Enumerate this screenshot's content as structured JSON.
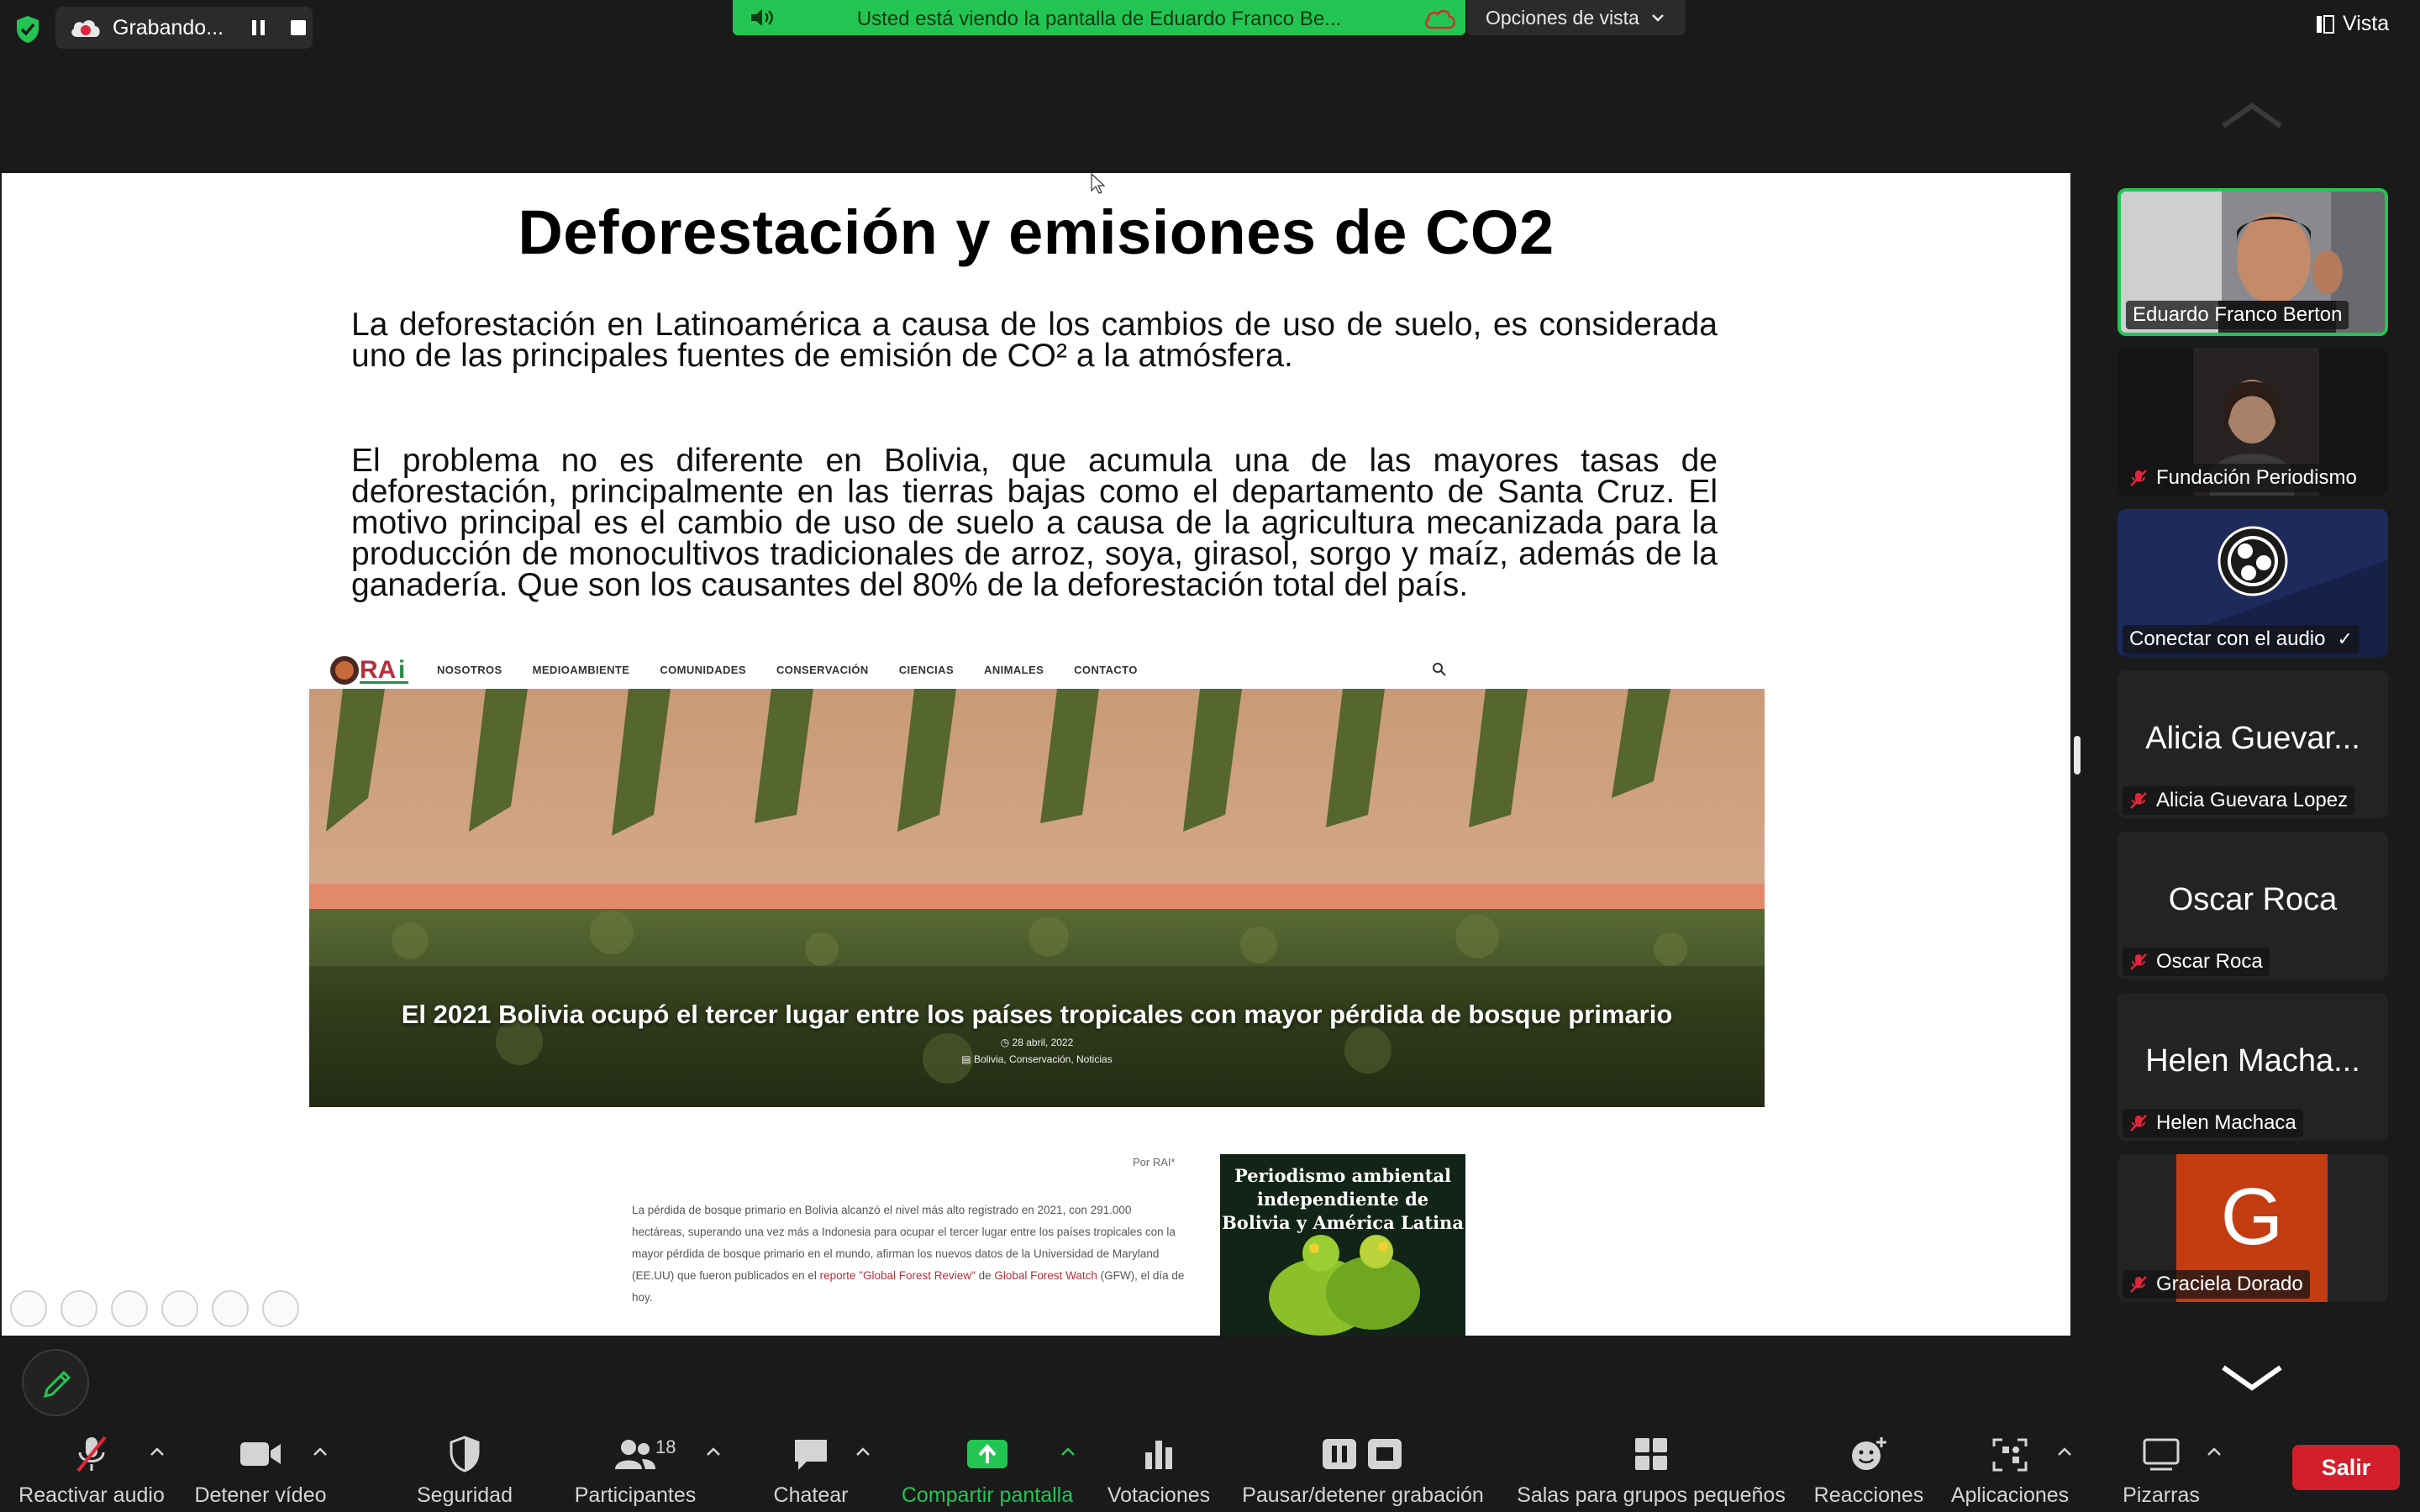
{
  "recording": {
    "label": "Grabando..."
  },
  "share_banner": {
    "text": "Usted está viendo la pantalla de Eduardo Franco Be..."
  },
  "view_options": {
    "label": "Opciones de vista"
  },
  "view": {
    "label": "Vista"
  },
  "slide": {
    "title": "Deforestación y emisiones de CO2",
    "paragraph1": "La deforestación en Latinoamérica a causa de los cambios de uso de suelo, es considerada uno de las principales fuentes de emisión de CO² a la atmósfera.",
    "paragraph2": "El problema no es diferente en Bolivia, que acumula una de las mayores tasas de deforestación, principalmente en las tierras bajas como el departamento de Santa Cruz. El motivo principal es el cambio de uso de suelo a causa de la agricultura mecanizada para la producción de monocultivos tradicionales de arroz, soya, girasol, sorgo y maíz, además de la ganadería. Que son los causantes del 80% de la deforestación total del país.",
    "rai_nav": [
      "NOSOTROS",
      "MEDIOAMBIENTE",
      "COMUNIDADES",
      "CONSERVACIÓN",
      "CIENCIAS",
      "ANIMALES",
      "CONTACTO"
    ],
    "headline": "El 2021 Bolivia ocupó el tercer lugar entre los países tropicales con mayor pérdida de bosque primario",
    "headline_date": "◷ 28 abril, 2022",
    "headline_tags": "▤ Bolivia, Conservación, Noticias",
    "byline": "Por RAI*",
    "article_text": "La pérdida de bosque primario en Bolivia alcanzó el nivel más alto registrado en 2021, con 291.000 hectáreas, superando una vez más a Indonesia para ocupar el tercer lugar entre los países tropicales con la mayor pérdida de bosque primario en el mundo, afirman los nuevos datos de la Universidad de Maryland (EE.UU) que fueron publicados en el",
    "article_link1": "reporte \"Global Forest Review\"",
    "article_mid": " de ",
    "article_link2": "Global Forest Watch",
    "article_end": " (GFW), el día de hoy.",
    "book_title": "Periodismo ambiental independiente de Bolivia y América Latina"
  },
  "participants": [
    {
      "name": "Eduardo Franco Berton",
      "muted": false,
      "active": true
    },
    {
      "name": "Fundación Periodismo",
      "muted": true
    },
    {
      "name": "Conectar con el audio",
      "check": "✓"
    },
    {
      "name": "Alicia Guevara Lopez",
      "display": "Alicia Guevar...",
      "muted": true
    },
    {
      "name": "Oscar Roca",
      "display": "Oscar Roca",
      "muted": true
    },
    {
      "name": "Helen Machaca",
      "display": "Helen Macha...",
      "muted": true
    },
    {
      "name": "Graciela Dorado",
      "initial": "G",
      "muted": true
    }
  ],
  "toolbar": {
    "unmute": "Reactivar audio",
    "stop_video": "Detener vídeo",
    "security": "Seguridad",
    "participants": "Participantes",
    "participants_count": "18",
    "chat": "Chatear",
    "share": "Compartir pantalla",
    "polls": "Votaciones",
    "recording": "Pausar/detener grabación",
    "breakout": "Salas para grupos pequeños",
    "reactions": "Reacciones",
    "apps": "Aplicaciones",
    "whiteboards": "Pizarras",
    "leave": "Salir"
  },
  "colors": {
    "accent_green": "#23c552",
    "leave_red": "#d21f2b",
    "background": "#1a1a1a"
  }
}
